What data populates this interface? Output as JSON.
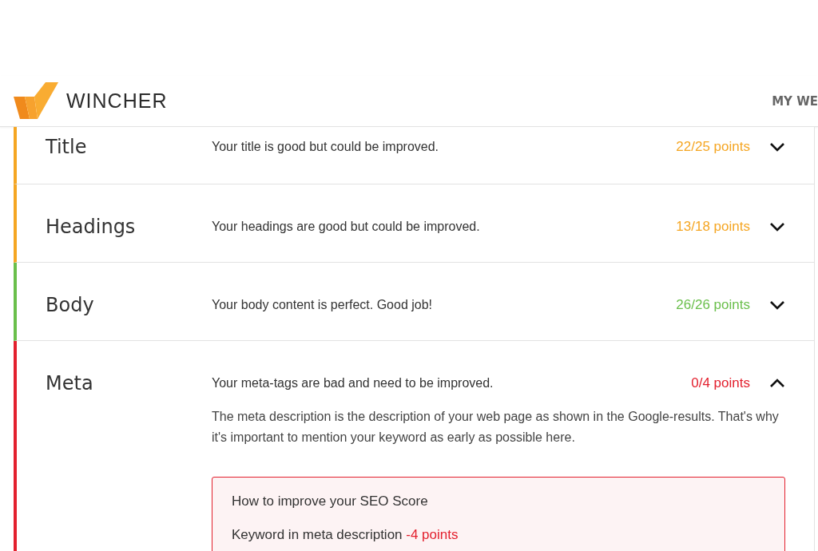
{
  "header": {
    "logo_text": "WINCHER",
    "nav_item": "MY WE"
  },
  "sections": [
    {
      "name": "Title",
      "summary": "Your title is good but could be improved.",
      "score": "22/25 points",
      "color": "#f5a623",
      "expanded": false
    },
    {
      "name": "Headings",
      "summary": "Your headings are good but could be improved.",
      "score": "13/18 points",
      "color": "#f5a623",
      "expanded": false
    },
    {
      "name": "Body",
      "summary": "Your body content is perfect. Good job!",
      "score": "26/26 points",
      "color": "#6abf4b",
      "expanded": false
    },
    {
      "name": "Meta",
      "summary": "Your meta-tags are bad and need to be improved.",
      "score": "0/4 points",
      "color": "#e3202e",
      "expanded": true,
      "description": "The meta description is the description of your web page as shown in the Google-results. That's why it's important to mention your keyword as early as possible here.",
      "tips": {
        "title": "How to improve your SEO Score",
        "items": [
          {
            "label": "Keyword in meta description",
            "penalty": "-4 points"
          }
        ]
      }
    }
  ]
}
